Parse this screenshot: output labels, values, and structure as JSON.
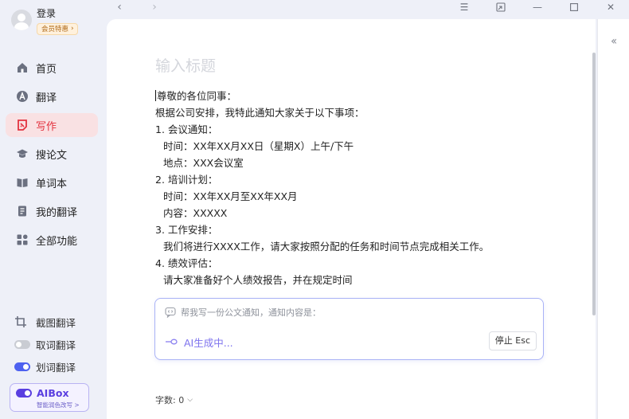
{
  "profile": {
    "login": "登录",
    "vip_badge": "会员特惠"
  },
  "nav": [
    {
      "label": "首页",
      "icon": "home-icon"
    },
    {
      "label": "翻译",
      "icon": "translate-icon"
    },
    {
      "label": "写作",
      "icon": "writing-icon",
      "active": true
    },
    {
      "label": "搜论文",
      "icon": "graduation-cap-icon"
    },
    {
      "label": "单词本",
      "icon": "book-icon"
    },
    {
      "label": "我的翻译",
      "icon": "document-icon"
    },
    {
      "label": "全部功能",
      "icon": "grid-icon"
    }
  ],
  "tools": [
    {
      "label": "截图翻译",
      "icon": "crop-icon"
    },
    {
      "label": "取词翻译",
      "toggle": "off"
    },
    {
      "label": "划词翻译",
      "toggle": "on"
    }
  ],
  "aibox": {
    "title": "AIBox",
    "subtitle": "智能润色改写 >"
  },
  "editor": {
    "title_placeholder": "输入标题",
    "lines": [
      {
        "text": "尊敬的各位同事：",
        "indent": false
      },
      {
        "text": "根据公司安排，我特此通知大家关于以下事项：",
        "indent": false
      },
      {
        "text": "1. 会议通知：",
        "indent": false
      },
      {
        "text": "时间：XX年XX月XX日（星期X）上午/下午",
        "indent": true
      },
      {
        "text": "地点：XXX会议室",
        "indent": true
      },
      {
        "text": "2. 培训计划：",
        "indent": false
      },
      {
        "text": "时间：XX年XX月至XX年XX月",
        "indent": true
      },
      {
        "text": "内容：XXXXX",
        "indent": true
      },
      {
        "text": "3. 工作安排：",
        "indent": false
      },
      {
        "text": "我们将进行XXXX工作，请大家按照分配的任务和时间节点完成相关工作。",
        "indent": true
      },
      {
        "text": "4. 绩效评估：",
        "indent": false
      },
      {
        "text": "请大家准备好个人绩效报告，并在规定时间",
        "indent": true
      }
    ]
  },
  "ai_assistant": {
    "prompt": "帮我写一份公文通知，通知内容是：",
    "status": "AI生成中...",
    "stop_label": "停止 Esc"
  },
  "word_count": "字数: 0",
  "colors": {
    "accent_red": "#e3323f",
    "active_bg": "#f9e1e3",
    "ai_purple": "#7d72ee",
    "toggle_on": "#4d61f0"
  }
}
